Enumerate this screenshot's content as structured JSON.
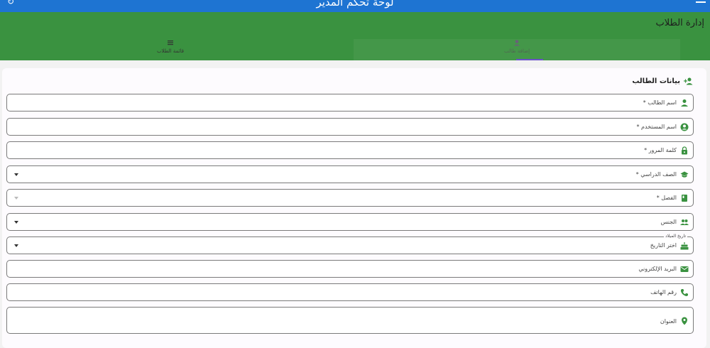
{
  "appbar": {
    "title": "لوحة تحكم المدير"
  },
  "header": {
    "title": "إدارة الطلاب"
  },
  "tabs": [
    {
      "label": "قائمة الطلاب",
      "icon": "list-icon"
    },
    {
      "label": "إضافة طالب",
      "icon": "person-add-icon",
      "selected": true
    }
  ],
  "form": {
    "section_title": "بيانات الطالب",
    "fields": [
      {
        "label": "اسم الطالب *",
        "icon": "person-icon"
      },
      {
        "label": "اسم المستخدم *",
        "icon": "account-circle-icon"
      },
      {
        "label": "كلمة المرور *",
        "icon": "lock-icon"
      },
      {
        "label": "الصف الدراسي *",
        "icon": "school-icon",
        "dropdown": true
      },
      {
        "label": "الفصل *",
        "icon": "book-icon",
        "dropdown": true,
        "disabled": true
      },
      {
        "label": "الجنس",
        "icon": "people-icon",
        "dropdown": true
      },
      {
        "label": "اختر التاريخ",
        "floating_label": "تاريخ الميلاد",
        "icon": "cake-icon",
        "dropdown": true
      },
      {
        "label": "البريد الإلكتروني",
        "icon": "email-icon"
      },
      {
        "label": "رقم الهاتف",
        "icon": "phone-icon"
      },
      {
        "label": "العنوان",
        "icon": "location-icon"
      }
    ]
  },
  "colors": {
    "appbar": "#1e74d2",
    "header": "#3a9240",
    "icon": "#3a9240",
    "tab_indicator": "#6b52c8"
  }
}
